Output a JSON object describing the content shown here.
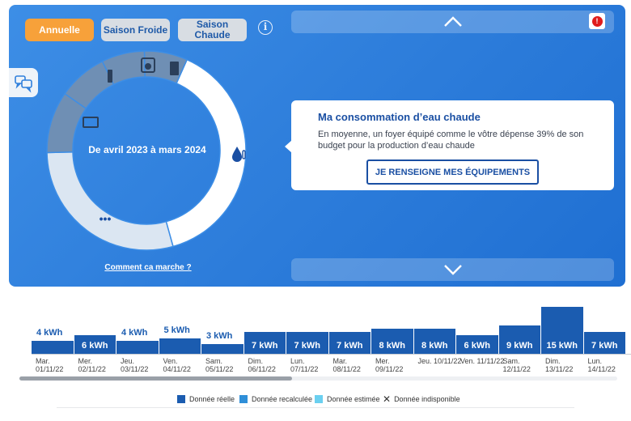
{
  "tabs": {
    "annual": "Annuelle",
    "cold": "Saison Froide",
    "hot": "Saison Chaude"
  },
  "info_symbol": "i",
  "donut": {
    "period": "De avril 2023 à mars 2024",
    "more_symbol": "•••",
    "segments": [
      {
        "name": "hot-water",
        "color": "#ffffff",
        "share": 0.39
      },
      {
        "name": "other",
        "color": "#dbe6f2",
        "share": 0.29
      },
      {
        "name": "appliance-1",
        "color": "#6f8fb4",
        "share": 0.1
      },
      {
        "name": "appliance-2",
        "color": "#6f8fb4",
        "share": 0.08
      },
      {
        "name": "appliance-3",
        "color": "#6f8fb4",
        "share": 0.07
      },
      {
        "name": "appliance-4",
        "color": "#6f8fb4",
        "share": 0.07
      }
    ]
  },
  "how_it_works": "Comment ca marche ?",
  "card": {
    "title": "Ma consommation d’eau chaude",
    "text": "En moyenne, un foyer équipé comme le vôtre dépense 39% de son budget pour la production d’eau chaude",
    "button": "JE RENSEIGNE MES ÉQUIPEMENTS"
  },
  "alert_symbol": "!",
  "colors": {
    "accent": "#f7a13a",
    "primary": "#1b5cb0",
    "reel": "#1b5cb0",
    "recalculee": "#2f8fd8",
    "estimee": "#6bd0f0"
  },
  "chart_data": {
    "type": "bar",
    "unit": "kWh",
    "categories": [
      {
        "day": "Mar.",
        "date": "01/11/22"
      },
      {
        "day": "Mer.",
        "date": "02/11/22"
      },
      {
        "day": "Jeu.",
        "date": "03/11/22"
      },
      {
        "day": "Ven.",
        "date": "04/11/22"
      },
      {
        "day": "Sam.",
        "date": "05/11/22"
      },
      {
        "day": "Dim.",
        "date": "06/11/22"
      },
      {
        "day": "Lun.",
        "date": "07/11/22"
      },
      {
        "day": "Mar.",
        "date": "08/11/22"
      },
      {
        "day": "Mer.",
        "date": "09/11/22"
      },
      {
        "day": "Jeu.",
        "date": "10/11/22"
      },
      {
        "day": "Ven.",
        "date": "11/11/22"
      },
      {
        "day": "Sam.",
        "date": "12/11/22"
      },
      {
        "day": "Dim.",
        "date": "13/11/22"
      },
      {
        "day": "Lun.",
        "date": "14/11/22"
      }
    ],
    "values": [
      4,
      6,
      4,
      5,
      3,
      7,
      7,
      7,
      8,
      8,
      6,
      9,
      15,
      7
    ],
    "labels": [
      "4 kWh",
      "6 kWh",
      "4 kWh",
      "5 kWh",
      "3 kWh",
      "7 kWh",
      "7 kWh",
      "7 kWh",
      "8 kWh",
      "8 kWh",
      "6 kWh",
      "9 kWh",
      "15 kWh",
      "7 kWh"
    ],
    "legend": [
      "Donnée réelle",
      "Donnée recalculée",
      "Donnée estimée",
      "Donnée indisponible"
    ]
  }
}
